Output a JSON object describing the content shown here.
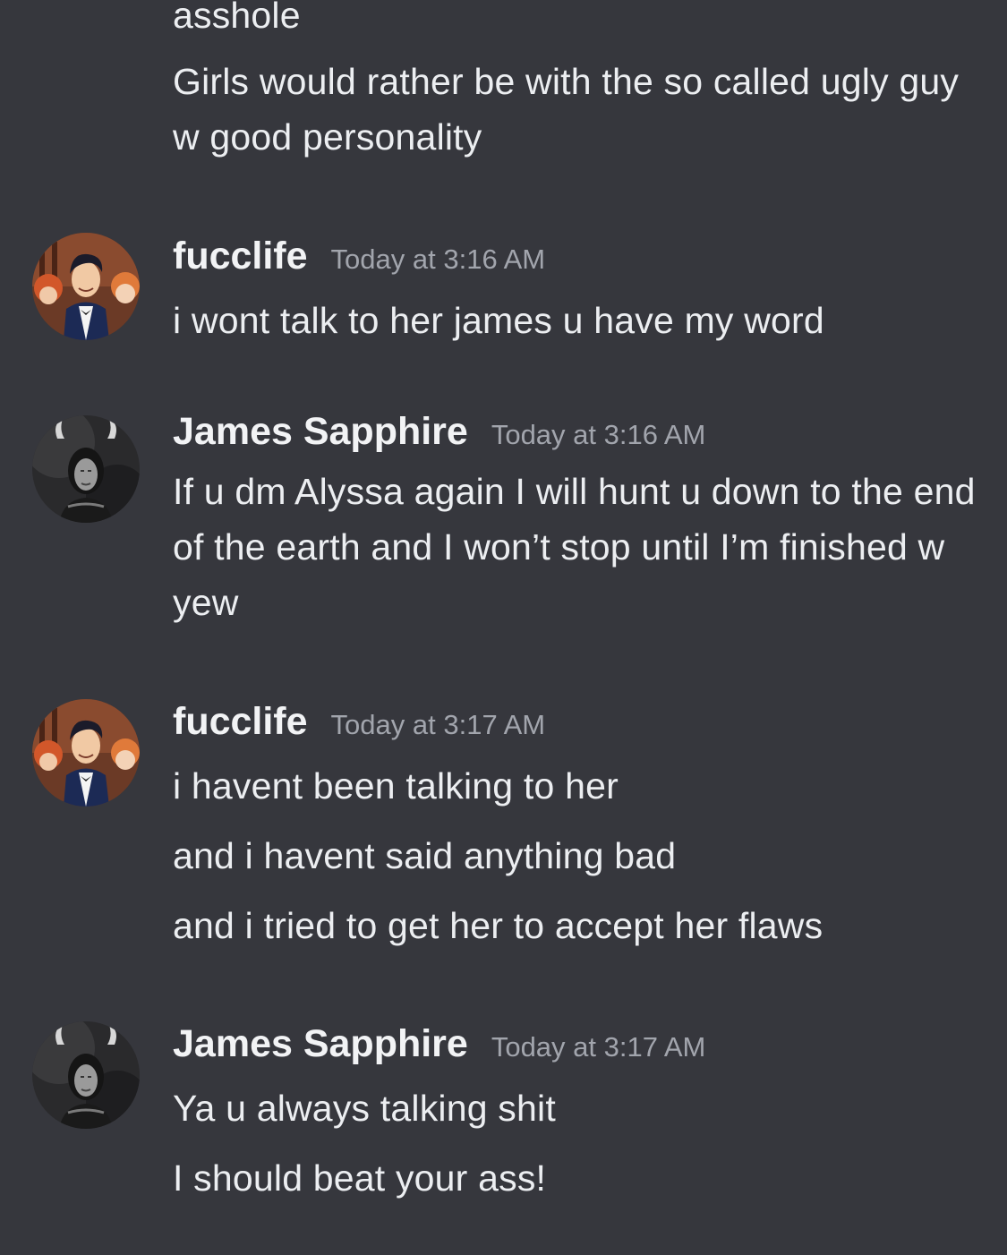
{
  "prev": {
    "line_partial": "asshole",
    "line_2": "Girls would rather be with the so called ugly guy w good personality"
  },
  "messages": [
    {
      "username": "fucclife",
      "timestamp": "Today at 3:16 AM",
      "avatar": "comic-man-tuxedo-avatar",
      "lines": [
        "i wont talk to her james u have my word"
      ]
    },
    {
      "username": "James Sapphire",
      "timestamp": "Today at 3:16 AM",
      "avatar": "dark-horned-figure-avatar",
      "lines": [
        "If u dm Alyssa again I will hunt u down to the end of the earth and I won’t stop until I’m finished w yew"
      ]
    },
    {
      "username": "fucclife",
      "timestamp": "Today at 3:17 AM",
      "avatar": "comic-man-tuxedo-avatar",
      "lines": [
        "i havent been talking to her",
        "and i havent said anything bad",
        "and i tried to get her to accept her flaws"
      ]
    },
    {
      "username": "James Sapphire",
      "timestamp": "Today at 3:17 AM",
      "avatar": "dark-horned-figure-avatar",
      "lines": [
        "Ya u always talking shit",
        "I should beat your ass!"
      ]
    }
  ],
  "colors": {
    "background": "#36373d",
    "text": "#eceef1",
    "username": "#f2f3f5",
    "timestamp": "#a2a5ad"
  }
}
